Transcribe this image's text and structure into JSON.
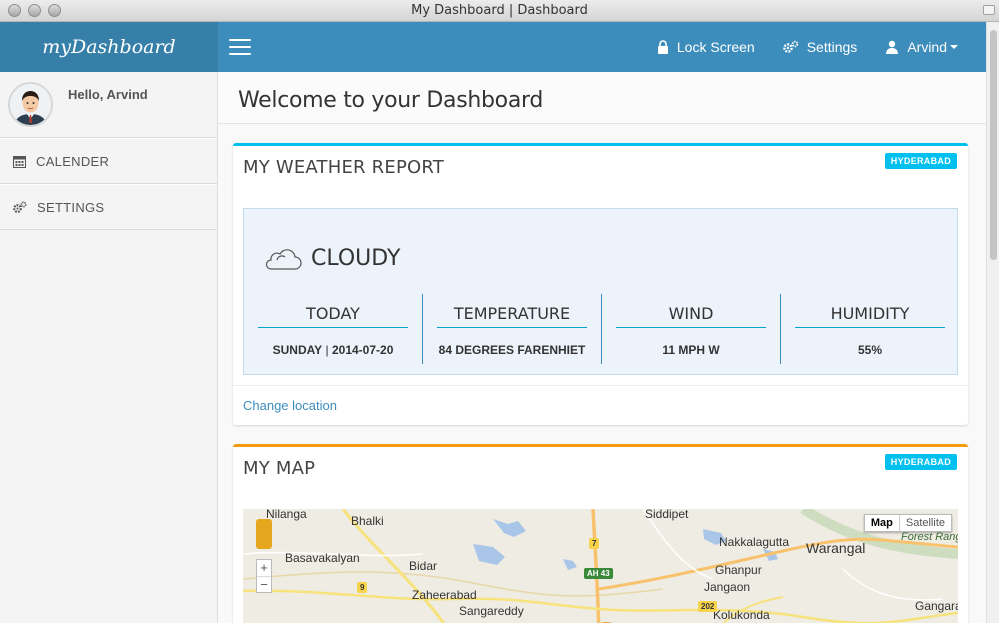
{
  "window": {
    "title": "My Dashboard | Dashboard"
  },
  "brand": "myDashboard",
  "navbar": {
    "lock_screen": "Lock Screen",
    "settings": "Settings",
    "user": "Arvind"
  },
  "sidebar": {
    "greeting": "Hello, Arvind",
    "items": [
      {
        "label": "CALENDER",
        "icon": "calendar-icon"
      },
      {
        "label": "SETTINGS",
        "icon": "gears-icon"
      }
    ]
  },
  "page": {
    "title": "Welcome to your Dashboard"
  },
  "weather": {
    "title": "MY WEATHER REPORT",
    "badge": "HYDERABAD",
    "condition": "CLOUDY",
    "stats": [
      {
        "label": "TODAY",
        "value_day": "SUNDAY",
        "value_date": "2014-07-20"
      },
      {
        "label": "TEMPERATURE",
        "value": "84 DEGREES FARENHIET"
      },
      {
        "label": "WIND",
        "value": "11 MPH W"
      },
      {
        "label": "HUMIDITY",
        "value": "55%"
      }
    ],
    "change_location": "Change location"
  },
  "map": {
    "title": "MY MAP",
    "badge": "HYDERABAD",
    "map_types": {
      "map": "Map",
      "satellite": "Satellite"
    },
    "places": [
      "Nilanga",
      "Bhalki",
      "Siddipet",
      "Basavakalyan",
      "Bidar",
      "Nakkalagutta",
      "Warangal",
      "Ghanpur",
      "Jangaon",
      "Zaheerabad",
      "Sangareddy",
      "Kolukonda",
      "Gangaram",
      "Forest Range"
    ],
    "road_shields": [
      "7",
      "9",
      "AH 43",
      "202"
    ],
    "zoom": {
      "plus": "+",
      "minus": "−"
    }
  },
  "colors": {
    "brand_bg": "#367fa9",
    "navbar_bg": "#3c8dbc",
    "weather_accent": "#00c0ef",
    "map_accent": "#f39c12"
  }
}
